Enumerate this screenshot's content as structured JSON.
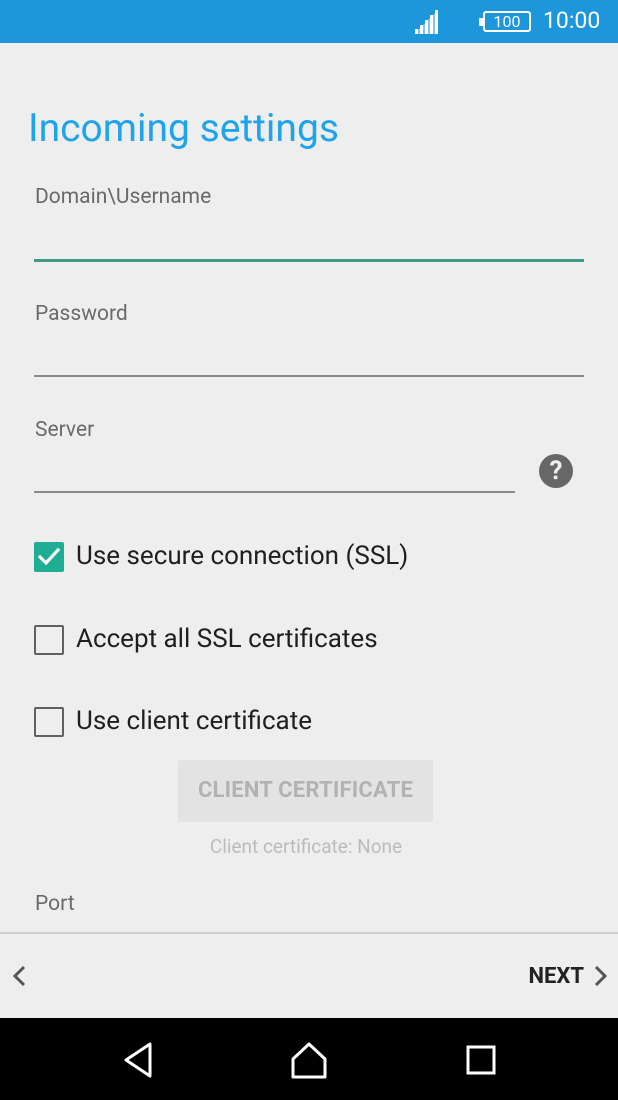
{
  "status_bar": {
    "battery": "100",
    "time": "10:00",
    "icons": [
      "signal-icon",
      "battery-icon"
    ]
  },
  "screen": {
    "title": "Incoming settings"
  },
  "fields": {
    "username_label": "Domain\\Username",
    "password_label": "Password",
    "server_label": "Server",
    "port_label": "Port"
  },
  "help": {
    "symbol": "?"
  },
  "checkboxes": [
    {
      "label": "Use secure connection (SSL)",
      "checked": true
    },
    {
      "label": "Accept all SSL certificates",
      "checked": false
    },
    {
      "label": "Use client certificate",
      "checked": false
    }
  ],
  "client_certificate": {
    "button_label": "CLIENT CERTIFICATE",
    "status": "Client certificate: None"
  },
  "bottom_bar": {
    "next_label": "NEXT"
  },
  "colors": {
    "status_bar": "#1e96dc",
    "title": "#1ea4ea",
    "accent": "#1fad94",
    "active_underline": "#3f9a87"
  }
}
